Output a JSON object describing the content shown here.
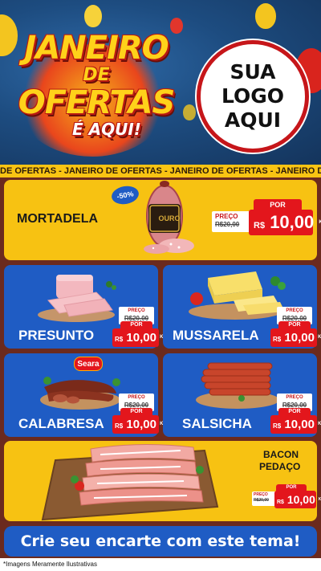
{
  "header": {
    "title_line1": "JANEIRO",
    "title_line2": "DE",
    "title_line3": "OFERTAS",
    "title_line4": "É AQUI!",
    "logo_line1": "SUA",
    "logo_line2": "LOGO",
    "logo_line3": "AQUI"
  },
  "ticker": "DE OFERTAS - JANEIRO DE OFERTAS - JANEIRO DE OFERTAS - JANEIRO DE OFERTAS - JANEIRO DE OFERTAS",
  "products": {
    "mortadela": {
      "name": "MORTADELA",
      "discount": "-50%",
      "brand": "OURO",
      "preco_label": "PREÇO",
      "old_price": "R$20,00",
      "por_label": "POR",
      "currency": "R$",
      "new_price": "10,00",
      "unit": "KG"
    },
    "presunto": {
      "name": "PRESUNTO",
      "preco_label": "PREÇO",
      "old_price": "R$20,00",
      "por_label": "POR",
      "currency": "R$",
      "new_price": "10,00",
      "unit": "KG"
    },
    "mussarela": {
      "name": "MUSSARELA",
      "preco_label": "PREÇO",
      "old_price": "R$20,00",
      "por_label": "POR",
      "currency": "R$",
      "new_price": "10,00",
      "unit": "KG"
    },
    "calabresa": {
      "name": "CALABRESA",
      "brand": "Seara",
      "preco_label": "PREÇO",
      "old_price": "R$20,00",
      "por_label": "POR",
      "currency": "R$",
      "new_price": "10,00",
      "unit": "KG"
    },
    "salsicha": {
      "name": "SALSICHA",
      "preco_label": "PREÇO",
      "old_price": "R$20,00",
      "por_label": "POR",
      "currency": "R$",
      "new_price": "10,00",
      "unit": "KG"
    },
    "bacon": {
      "name_line1": "BACON",
      "name_line2": "PEDAÇO",
      "preco_label": "PREÇO",
      "old_price": "R$20,00",
      "por_label": "POR",
      "currency": "R$",
      "new_price": "10,00",
      "unit": "KG"
    }
  },
  "footer": {
    "cta": "Crie seu encarte com este tema!",
    "disclaimer": "*Imagens Meramente Ilustrativas"
  },
  "colors": {
    "yellow": "#f7c212",
    "blue": "#1f5cc4",
    "red": "#e3161c",
    "background": "#6b2a1e"
  }
}
